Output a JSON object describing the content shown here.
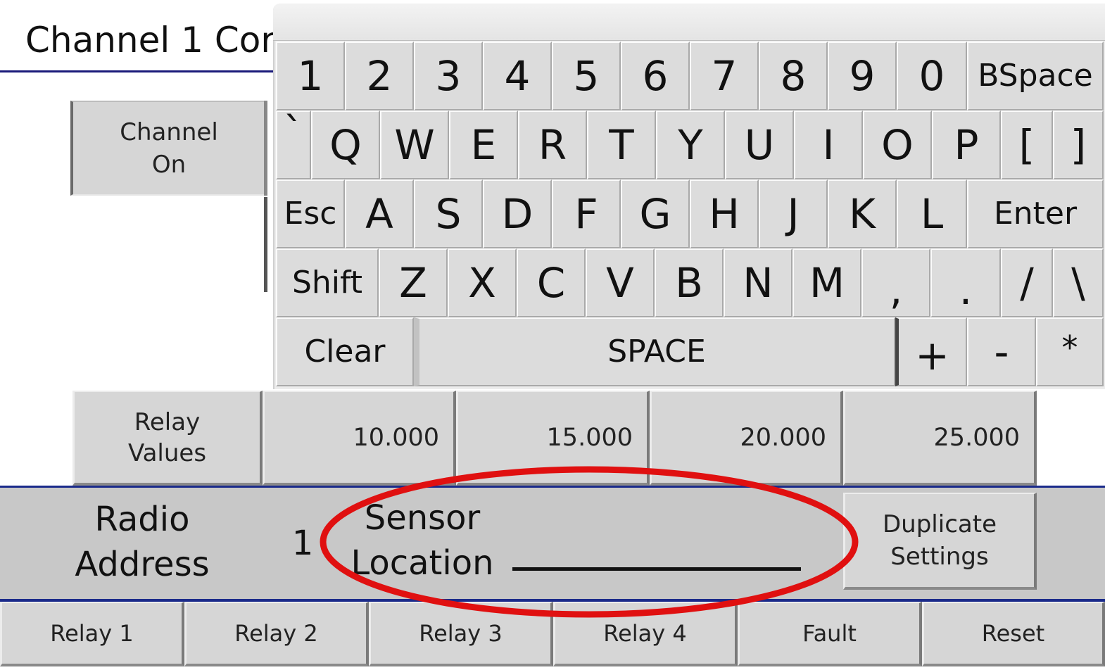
{
  "header": {
    "title": "Channel 1 Cor"
  },
  "left_buttons": {
    "channel_on": "Channel\nOn",
    "relay_values": "Relay\nValues"
  },
  "relay_values": [
    "10.000",
    "15.000",
    "20.000",
    "25.000"
  ],
  "keyboard": {
    "row1": [
      "1",
      "2",
      "3",
      "4",
      "5",
      "6",
      "7",
      "8",
      "9",
      "0",
      "BSpace"
    ],
    "row2": [
      "`",
      "Q",
      "W",
      "E",
      "R",
      "T",
      "Y",
      "U",
      "I",
      "O",
      "P",
      "[",
      "]"
    ],
    "row3": [
      "Esc",
      "A",
      "S",
      "D",
      "F",
      "G",
      "H",
      "J",
      "K",
      "L",
      "Enter"
    ],
    "row4": [
      "Shift",
      "Z",
      "X",
      "C",
      "V",
      "B",
      "N",
      "M",
      ",",
      ".",
      "/",
      "\\"
    ],
    "row5": [
      "Clear",
      "SPACE",
      "+",
      "-",
      "*"
    ]
  },
  "panel": {
    "radio_address_label": "Radio\nAddress",
    "radio_address_value": "1",
    "sensor_location_label": "Sensor\nLocation",
    "sensor_location_value": "",
    "duplicate_settings": "Duplicate\nSettings"
  },
  "tabs": [
    "Relay 1",
    "Relay 2",
    "Relay 3",
    "Relay 4",
    "Fault",
    "Reset"
  ],
  "colors": {
    "accent_line": "#1a2a8a",
    "highlight_ellipse": "#e01010",
    "button_face": "#d6d6d6"
  }
}
